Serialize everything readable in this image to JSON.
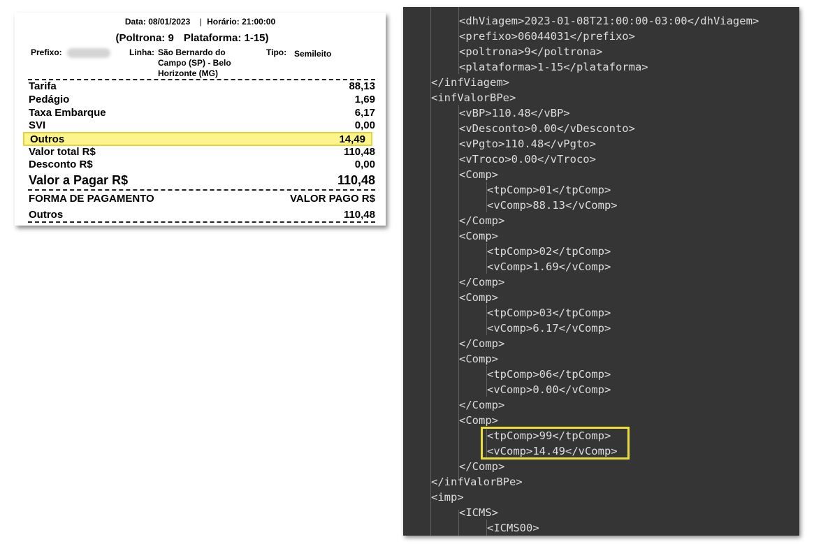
{
  "receipt": {
    "data_label": "Data:",
    "data_value": "08/01/2023",
    "sep": "|",
    "horario_label": "Horário:",
    "horario_value": "21:00:00",
    "poltrona": "(Poltrona: 9",
    "plataforma": "Plataforma: 1-15)",
    "prefixo_label": "Prefixo:",
    "linha_label": "Linha:",
    "linha_value": "São Bernardo do Campo (SP) - Belo Horizonte (MG)",
    "tipo_label": "Tipo:",
    "tipo_value": "Semileito",
    "rows": [
      {
        "label": "Tarifa",
        "value": "88,13"
      },
      {
        "label": "Pedágio",
        "value": "1,69"
      },
      {
        "label": "Taxa Embarque",
        "value": "6,17"
      },
      {
        "label": "SVI",
        "value": "0,00"
      },
      {
        "label": "Outros",
        "value": "14,49"
      },
      {
        "label": "Valor total R$",
        "value": "110,48"
      },
      {
        "label": "Desconto R$",
        "value": "0,00"
      },
      {
        "label": "Valor a Pagar R$",
        "value": "110,48"
      }
    ],
    "payment_header_left": "FORMA DE PAGAMENTO",
    "payment_header_right": "VALOR PAGO R$",
    "payment_row": {
      "label": "Outros",
      "value": "110,48"
    },
    "highlight_color": "#fdf58c"
  },
  "code": {
    "lines": [
      "<dhViagem>2023-01-08T21:00:00-03:00</dhViagem>",
      "<prefixo>06044031</prefixo>",
      "<poltrona>9</poltrona>",
      "<plataforma>1-15</plataforma>",
      "</infViagem>",
      "<infValorBPe>",
      "<vBP>110.48</vBP>",
      "<vDesconto>0.00</vDesconto>",
      "<vPgto>110.48</vPgto>",
      "<vTroco>0.00</vTroco>",
      "<Comp>",
      "<tpComp>01</tpComp>",
      "<vComp>88.13</vComp>",
      "</Comp>",
      "<Comp>",
      "<tpComp>02</tpComp>",
      "<vComp>1.69</vComp>",
      "</Comp>",
      "<Comp>",
      "<tpComp>03</tpComp>",
      "<vComp>6.17</vComp>",
      "</Comp>",
      "<Comp>",
      "<tpComp>06</tpComp>",
      "<vComp>0.00</vComp>",
      "</Comp>",
      "<Comp>",
      "<tpComp>99</tpComp>",
      "<vComp>14.49</vComp>",
      "</Comp>",
      "</infValorBPe>",
      "<imp>",
      "<ICMS>",
      "<ICMS00>"
    ],
    "background": "#353535",
    "highlight_color": "#ecde3a"
  }
}
